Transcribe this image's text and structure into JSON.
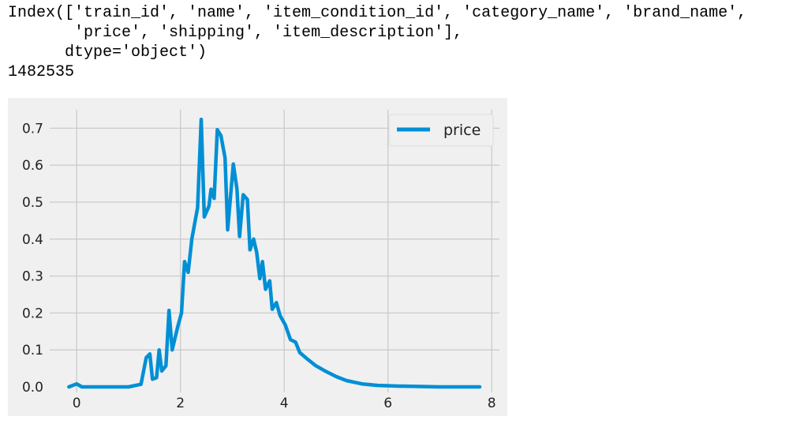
{
  "output": {
    "lines": [
      "Index(['train_id', 'name', 'item_condition_id', 'category_name', 'brand_name',",
      "       'price', 'shipping', 'item_description'],",
      "      dtype='object')",
      "1482535"
    ]
  },
  "chart_data": {
    "type": "line",
    "title": "",
    "xlabel": "",
    "ylabel": "",
    "xlim": [
      -0.52,
      8.15
    ],
    "ylim": [
      -0.015,
      0.75
    ],
    "xticks": [
      "0",
      "2",
      "4",
      "6",
      "8"
    ],
    "yticks": [
      "0.0",
      "0.1",
      "0.2",
      "0.3",
      "0.4",
      "0.5",
      "0.6",
      "0.7"
    ],
    "grid": true,
    "legend_position": "top-right",
    "background": "#f0f0f0",
    "series": [
      {
        "name": "price",
        "color": "#008fd5",
        "x": [
          -0.15,
          0.0,
          0.1,
          0.3,
          1.0,
          1.24,
          1.34,
          1.41,
          1.46,
          1.54,
          1.59,
          1.64,
          1.72,
          1.78,
          1.84,
          1.95,
          2.02,
          2.08,
          2.15,
          2.22,
          2.33,
          2.4,
          2.46,
          2.55,
          2.59,
          2.65,
          2.71,
          2.78,
          2.86,
          2.91,
          3.02,
          3.09,
          3.14,
          3.21,
          3.29,
          3.34,
          3.41,
          3.47,
          3.53,
          3.58,
          3.64,
          3.72,
          3.77,
          3.85,
          3.92,
          4.02,
          4.12,
          4.22,
          4.3,
          4.45,
          4.6,
          4.8,
          5.0,
          5.2,
          5.5,
          5.8,
          6.2,
          7.0,
          7.77
        ],
        "y": [
          0.0,
          0.008,
          0.0,
          0.0,
          0.0,
          0.007,
          0.079,
          0.089,
          0.021,
          0.025,
          0.1,
          0.043,
          0.057,
          0.207,
          0.1,
          0.164,
          0.2,
          0.339,
          0.31,
          0.4,
          0.485,
          0.724,
          0.46,
          0.489,
          0.535,
          0.51,
          0.696,
          0.68,
          0.62,
          0.425,
          0.603,
          0.535,
          0.407,
          0.52,
          0.507,
          0.371,
          0.4,
          0.364,
          0.293,
          0.339,
          0.264,
          0.287,
          0.21,
          0.228,
          0.193,
          0.168,
          0.128,
          0.121,
          0.093,
          0.075,
          0.058,
          0.042,
          0.028,
          0.017,
          0.008,
          0.004,
          0.002,
          0.0,
          0.0
        ]
      }
    ]
  }
}
